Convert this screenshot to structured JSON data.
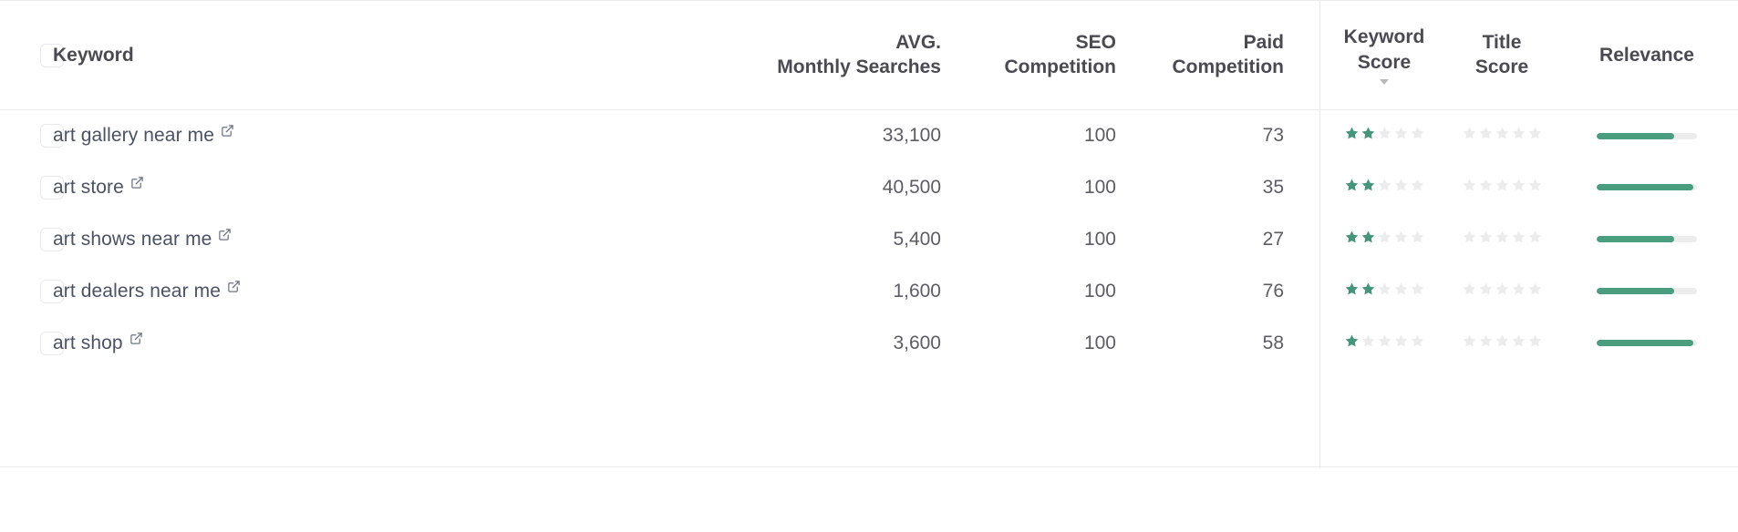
{
  "table": {
    "select_all_checkbox": "unchecked",
    "columns": [
      {
        "key": "keyword",
        "label": "Keyword",
        "lines": [
          "Keyword"
        ],
        "align": "left",
        "sorted": false
      },
      {
        "key": "avg_monthly",
        "label": "AVG. Monthly Searches",
        "lines": [
          "AVG.",
          "Monthly Searches"
        ],
        "align": "right",
        "sorted": false
      },
      {
        "key": "seo_comp",
        "label": "SEO Competition",
        "lines": [
          "SEO",
          "Competition"
        ],
        "align": "right",
        "sorted": false
      },
      {
        "key": "paid_comp",
        "label": "Paid Competition",
        "lines": [
          "Paid",
          "Competition"
        ],
        "align": "right",
        "sorted": false
      },
      {
        "key": "kw_score",
        "label": "Keyword Score",
        "lines": [
          "Keyword",
          "Score"
        ],
        "align": "center",
        "sorted": true,
        "sort_direction": "descending",
        "sort_icon": "caret-down-icon"
      },
      {
        "key": "title_score",
        "label": "Title Score",
        "lines": [
          "Title",
          "Score"
        ],
        "align": "center",
        "sorted": false
      },
      {
        "key": "relevance",
        "label": "Relevance",
        "lines": [
          "Relevance"
        ],
        "align": "center",
        "sorted": false
      }
    ],
    "max_stars": 5,
    "rows": [
      {
        "selected": false,
        "keyword": "art gallery near me",
        "external_link_icon": "external-link-icon",
        "avg_monthly_searches": "33,100",
        "seo_competition": "100",
        "paid_competition": "73",
        "keyword_score_stars": 2,
        "title_score_stars": 0,
        "relevance_percent": 77
      },
      {
        "selected": false,
        "keyword": "art store",
        "external_link_icon": "external-link-icon",
        "avg_monthly_searches": "40,500",
        "seo_competition": "100",
        "paid_competition": "35",
        "keyword_score_stars": 2,
        "title_score_stars": 0,
        "relevance_percent": 96
      },
      {
        "selected": false,
        "keyword": "art shows near me",
        "external_link_icon": "external-link-icon",
        "avg_monthly_searches": "5,400",
        "seo_competition": "100",
        "paid_competition": "27",
        "keyword_score_stars": 2,
        "title_score_stars": 0,
        "relevance_percent": 77
      },
      {
        "selected": false,
        "keyword": "art dealers near me",
        "external_link_icon": "external-link-icon",
        "avg_monthly_searches": "1,600",
        "seo_competition": "100",
        "paid_competition": "76",
        "keyword_score_stars": 2,
        "title_score_stars": 0,
        "relevance_percent": 77
      },
      {
        "selected": false,
        "keyword": "art shop",
        "external_link_icon": "external-link-icon",
        "avg_monthly_searches": "3,600",
        "seo_competition": "100",
        "paid_competition": "58",
        "keyword_score_stars": 1,
        "title_score_stars": 0,
        "relevance_percent": 96
      }
    ]
  },
  "colors": {
    "star_filled": "#45957a",
    "star_empty": "#ececec",
    "relevance_fill": "#4a9e7f",
    "relevance_track": "#ececec",
    "header_text": "#4a4a52",
    "body_text": "#5c5c66",
    "keyword_text": "#4a5264",
    "border": "#ececef"
  }
}
